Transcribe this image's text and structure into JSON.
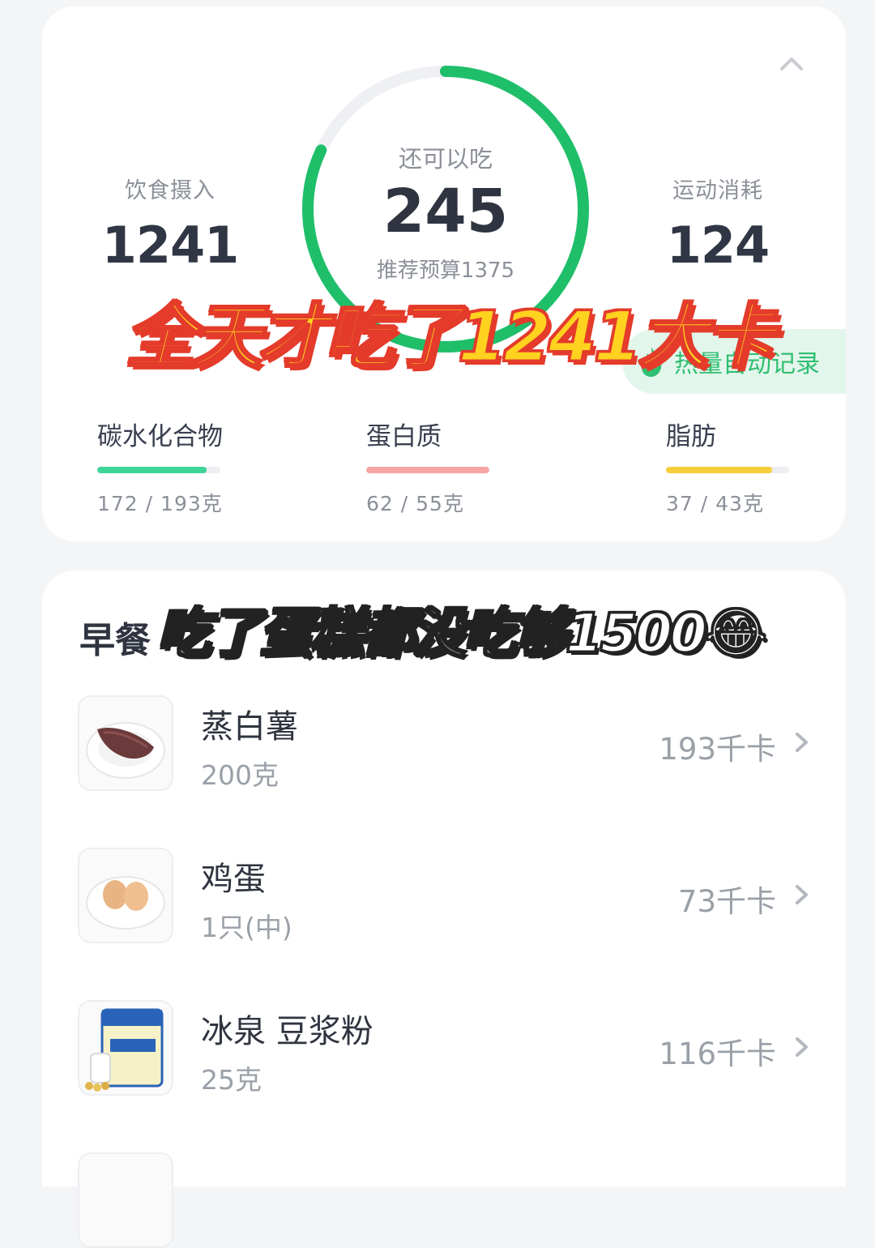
{
  "summary": {
    "intake_label": "饮食摄入",
    "intake_value": "1241",
    "remaining_label": "还可以吃",
    "remaining_value": "245",
    "budget_text": "推荐预算1375",
    "burn_label": "运动消耗",
    "burn_value": "124",
    "auto_record_label": "热量自动记录",
    "ring_progress": 0.82,
    "ring_color": "#1fbf6a"
  },
  "macros": [
    {
      "name": "碳水化合物",
      "amount": "172 / 193克",
      "fraction": 0.89,
      "color": "#3dd598"
    },
    {
      "name": "蛋白质",
      "amount": "62 / 55克",
      "fraction": 1.0,
      "color": "#f7a4a4"
    },
    {
      "name": "脂肪",
      "amount": "37 / 43克",
      "fraction": 0.86,
      "color": "#f7cd3c"
    }
  ],
  "overlay": {
    "title": "全天才吃了1241大卡",
    "subtitle": "吃了蛋糕都没吃够1500😂"
  },
  "meal": {
    "title": "早餐",
    "items": [
      {
        "name": "蒸白薯",
        "qty": "200克",
        "kcal": "193千卡",
        "icon": "sweet-potato-icon"
      },
      {
        "name": "鸡蛋",
        "qty": "1只(中)",
        "kcal": "73千卡",
        "icon": "eggs-icon"
      },
      {
        "name": "冰泉 豆浆粉",
        "qty": "25克",
        "kcal": "116千卡",
        "icon": "soy-milk-powder-icon"
      }
    ]
  }
}
